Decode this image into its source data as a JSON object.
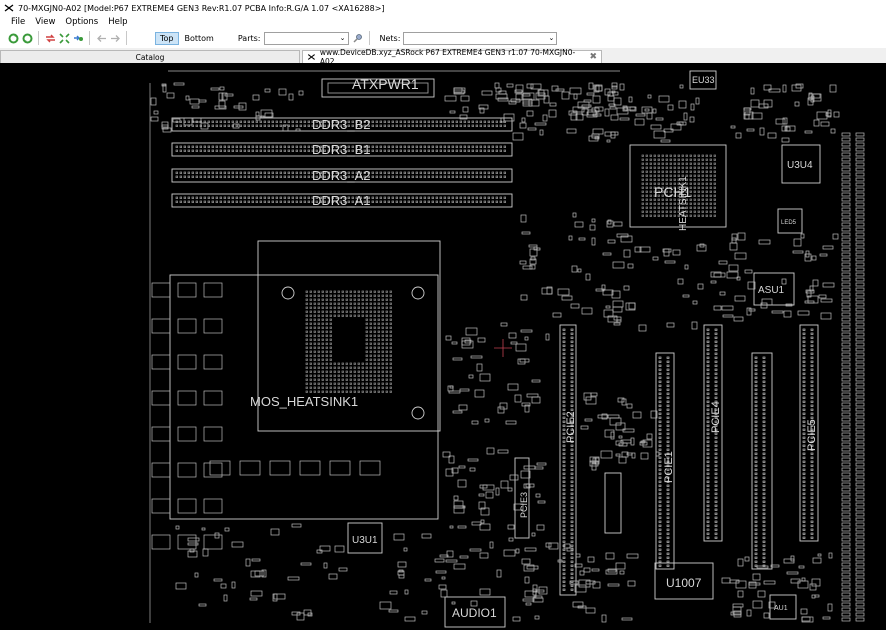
{
  "window": {
    "title": "70-MXGJN0-A02 [Model:P67 EXTREME4 GEN3 Rev:R1.07 PCBA Info:R.G/A 1.07   <XA16288>]"
  },
  "menu": [
    "File",
    "View",
    "Options",
    "Help"
  ],
  "toolbar": {
    "icons": [
      "reload-green-icon",
      "open-green-icon",
      "arrows-icon",
      "fit-icon",
      "zoom-arrows-icon",
      "back-icon",
      "forward-icon"
    ],
    "top_label": "Top",
    "bottom_label": "Bottom",
    "parts_label": "Parts:",
    "parts_value": "",
    "nets_label": "Nets:",
    "nets_value": ""
  },
  "tabs": {
    "catalog": "Catalog",
    "board": "www.DeviceDB.xyz_ASRock P67 EXTREME4 GEN3 r1.07 70-MXGJN0-A02"
  },
  "board": {
    "labels": {
      "atxpwr": "ATXPWR1",
      "ddr_b2": "DDR3_B2",
      "ddr_b1": "DDR3_B1",
      "ddr_a2": "DDR3_A2",
      "ddr_a1": "DDR3_A1",
      "pch": "PCH1",
      "heatsink": "HEATSINK1",
      "u3u4": "U3U4",
      "asu1": "ASU1",
      "mos_heatsink": "MOS_HEATSINK1",
      "pcie1": "PCIE1",
      "pcie2": "PCIE2",
      "pcie3": "PCIE3",
      "pcie4": "PCIE4",
      "pcie5": "PCIE5",
      "u3u1": "U3U1",
      "u1007": "U1007",
      "audio": "AUDIO1",
      "eu33": "EU33",
      "leds": "LED5",
      "au1": "AU1"
    }
  }
}
